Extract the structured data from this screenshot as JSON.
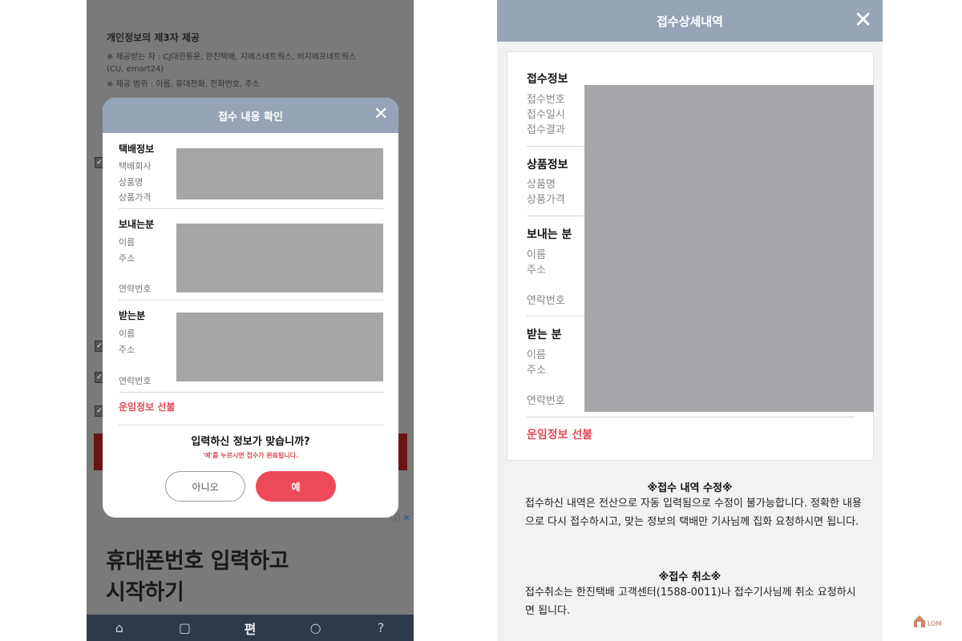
{
  "left": {
    "background": {
      "privacy_title": "개인정보의 제3자 제공",
      "recipients_line1": "※ 제공받는 자 : CJ대한통운, 한진택배, 지에스네트웍스, 비지에프네트웍스",
      "recipients_line2": "(CU, emart24)",
      "scope_line": "※ 제공 범위 : 이름, 휴대전화, 전화번호, 주소",
      "check_glyph": "✓",
      "ad_line1": "휴대폰번호 입력하고",
      "ad_line2": "시작하기",
      "ad_icons": "ⓘ ✕"
    },
    "bottom_nav": [
      {
        "icon": "home-icon",
        "glyph": "⌂"
      },
      {
        "icon": "box-icon",
        "glyph": "▢"
      },
      {
        "icon": "pyeon-logo-icon",
        "glyph": "편"
      },
      {
        "icon": "search-icon",
        "glyph": "○"
      },
      {
        "icon": "help-icon",
        "glyph": "?"
      }
    ],
    "modal": {
      "title": "접수 내용 확인",
      "close_glyph": "✕",
      "sections": [
        {
          "heading": "택배정보",
          "labels": [
            "택배회사",
            "상품명",
            "상품가격"
          ]
        },
        {
          "heading": "보내는분",
          "labels": [
            "이름",
            "주소",
            "연락번호"
          ]
        },
        {
          "heading": "받는분",
          "labels": [
            "이름",
            "주소",
            "연락번호"
          ]
        }
      ],
      "freight": "운임정보  선불",
      "question": "입력하신 정보가 맞습니까?",
      "note": "'예'를 누르시면 접수가 완료됩니다.",
      "no_label": "아니오",
      "yes_label": "예"
    }
  },
  "right": {
    "title": "접수상세내역",
    "close_glyph": "✕",
    "sections": [
      {
        "heading": "접수정보",
        "labels": [
          "접수번호",
          "접수일시",
          "접수결과"
        ]
      },
      {
        "heading": "상품정보",
        "labels": [
          "상품명",
          "상품가격"
        ]
      },
      {
        "heading": "보내는 분",
        "labels": [
          "이름",
          "주소",
          "연락번호"
        ]
      },
      {
        "heading": "받는 분",
        "labels": [
          "이름",
          "주소",
          "연락번호"
        ]
      }
    ],
    "freight": "운임정보  선불",
    "edit_heading": "※접수 내역 수정※",
    "edit_text": "접수하신 내역은 전산으로 자동 입력됨으로 수정이 불가능합니다. 정확한 내용으로 다시 접수하시고, 맞는 정보의 택배만 기사님께 집화 요청하시면 됩니다.",
    "cancel_heading": "※접수 취소※",
    "cancel_text": "접수취소는 한진택배 고객센터(1588-0011)나 접수기사님께 취소 요청하시면 됩니다."
  },
  "watermark": {
    "text": "LOM"
  },
  "colors": {
    "header": "#97a3b6",
    "accent_red": "#ef4a59",
    "redacted_gray": "#a6a6a6"
  }
}
